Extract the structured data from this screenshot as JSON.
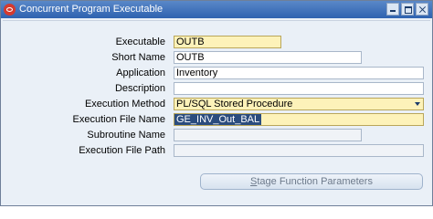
{
  "window": {
    "title": "Concurrent Program Executable"
  },
  "form": {
    "executable": {
      "label": "Executable",
      "value": "OUTB"
    },
    "short_name": {
      "label": "Short Name",
      "value": "OUTB"
    },
    "application": {
      "label": "Application",
      "value": "Inventory"
    },
    "description": {
      "label": "Description",
      "value": ""
    },
    "execution_method": {
      "label": "Execution Method",
      "value": "PL/SQL Stored Procedure"
    },
    "execution_file_name": {
      "label": "Execution File Name",
      "value": "GE_INV_Out_BAL"
    },
    "subroutine_name": {
      "label": "Subroutine Name",
      "value": ""
    },
    "execution_file_path": {
      "label": "Execution File Path",
      "value": ""
    }
  },
  "buttons": {
    "stage_function_parameters_first": "S",
    "stage_function_parameters_rest": "tage Function Parameters"
  },
  "colors": {
    "required_field": "#fdf2b9",
    "titlebar": "#2e62b0",
    "selection": "#2b4c7e"
  }
}
